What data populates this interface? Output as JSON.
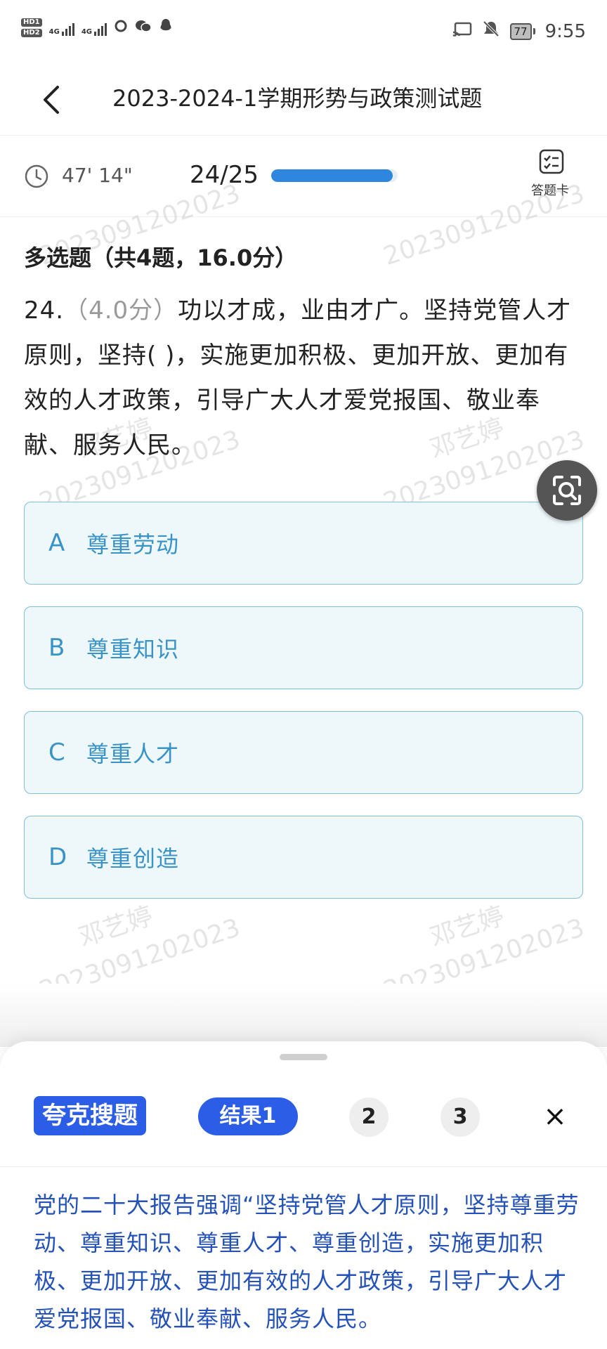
{
  "status_bar": {
    "left_hd": [
      "HD1",
      "HD2"
    ],
    "network_1": "4G",
    "network_2": "4G",
    "icons": [
      "hd-icon",
      "signal-icon",
      "browser-icon",
      "wechat-icon",
      "qq-icon"
    ],
    "right_icons": [
      "cast-icon",
      "mute-icon"
    ],
    "battery": "77",
    "time": "9:55"
  },
  "header": {
    "title": "2023-2024-1学期形势与政策测试题"
  },
  "progress": {
    "timer": "47' 14\"",
    "count": "24/25",
    "fraction": 0.96,
    "answer_card_label": "答题卡"
  },
  "section": {
    "title": "多选题（共4题，16.0分）"
  },
  "question": {
    "number": "24.",
    "points": "（4.0分）",
    "text": "功以才成，业由才广。坚持党管人才原则，坚持( )，实施更加积极、更加开放、更加有效的人才政策，引导广大人才爱党报国、敬业奉献、服务人民。"
  },
  "options": [
    {
      "letter": "A",
      "text": "尊重劳动"
    },
    {
      "letter": "B",
      "text": "尊重知识"
    },
    {
      "letter": "C",
      "text": "尊重人才"
    },
    {
      "letter": "D",
      "text": "尊重创造"
    }
  ],
  "watermark": {
    "name": "邓艺婷",
    "id": "2023091202023"
  },
  "sheet": {
    "brand": "夸克搜题",
    "tabs": [
      "结果1",
      "2",
      "3"
    ],
    "close": "×",
    "answer": "党的二十大报告强调“坚持党管人才原则，坚持尊重劳动、尊重知识、尊重人才、尊重创造，实施更加积极、更加开放、更加有效的人才政策，引导广大人才爱党报国、敬业奉献、服务人民。"
  },
  "colors": {
    "accent": "#2b5de6",
    "progress": "#2f86df",
    "option_text": "#3a93c7",
    "option_bg": "#eef8fb",
    "answer_text": "#2452b8"
  }
}
